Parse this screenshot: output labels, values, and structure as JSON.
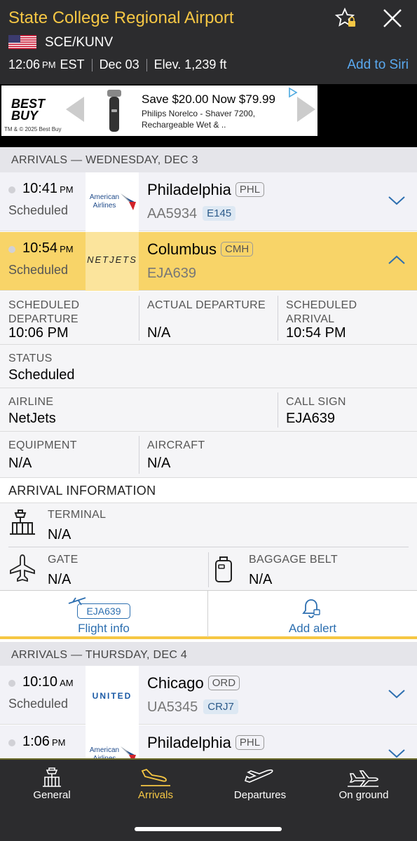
{
  "header": {
    "title": "State College Regional Airport",
    "codes": "SCE/KUNV",
    "time": "12:06",
    "time_ampm": "PM",
    "timezone": "EST",
    "date": "Dec 03",
    "elevation": "Elev. 1,239 ft",
    "siri_label": "Add to Siri",
    "accent_color": "#f6c744"
  },
  "ad": {
    "brand": "BEST BUY",
    "legal": "TM & © 2025 Best Buy",
    "headline": "Save $20.00 Now $79.99",
    "line1": "Philips Norelco - Shaver 7200,",
    "line2": "Rechargeable Wet & .."
  },
  "sections": [
    {
      "heading": "ARRIVALS — WEDNESDAY, DEC 3",
      "flights": [
        {
          "time": "10:41",
          "ampm": "PM",
          "status": "Scheduled",
          "airline_logo": "American Airlines",
          "city": "Philadelphia",
          "iata": "PHL",
          "flight": "AA5934",
          "equipment": "E145"
        },
        {
          "time": "10:54",
          "ampm": "PM",
          "status": "Scheduled",
          "airline_logo": "NETJETS",
          "city": "Columbus",
          "iata": "CMH",
          "flight": "EJA639",
          "equipment": ""
        }
      ]
    },
    {
      "heading": "ARRIVALS — THURSDAY, DEC 4",
      "flights": [
        {
          "time": "10:10",
          "ampm": "AM",
          "status": "Scheduled",
          "airline_logo": "UNITED",
          "city": "Chicago",
          "iata": "ORD",
          "flight": "UA5345",
          "equipment": "CRJ7"
        },
        {
          "time": "1:06",
          "ampm": "PM",
          "status": "",
          "airline_logo": "American Airlines",
          "city": "Philadelphia",
          "iata": "PHL",
          "flight": "",
          "equipment": ""
        }
      ]
    }
  ],
  "detail": {
    "sched_dep_label_1": "SCHEDULED",
    "sched_dep_label_2": "DEPARTURE",
    "sched_dep_value": "10:06 PM",
    "actual_dep_label": "ACTUAL DEPARTURE",
    "actual_dep_value": "N/A",
    "sched_arr_label_1": "SCHEDULED",
    "sched_arr_label_2": "ARRIVAL",
    "sched_arr_value": "10:54 PM",
    "status_label": "STATUS",
    "status_value": "Scheduled",
    "airline_label": "AIRLINE",
    "airline_value": "NetJets",
    "callsign_label": "CALL SIGN",
    "callsign_value": "EJA639",
    "equipment_label": "EQUIPMENT",
    "equipment_value": "N/A",
    "aircraft_label": "AIRCRAFT",
    "aircraft_value": "N/A",
    "arrival_info_heading": "ARRIVAL INFORMATION",
    "terminal_label": "TERMINAL",
    "terminal_value": "N/A",
    "gate_label": "GATE",
    "gate_value": "N/A",
    "baggage_label": "BAGGAGE BELT",
    "baggage_value": "N/A",
    "flight_info_pill": "EJA639",
    "flight_info_label": "Flight info",
    "add_alert_label": "Add alert"
  },
  "tabs": [
    {
      "label": "General",
      "icon": "control-tower-icon",
      "active": false
    },
    {
      "label": "Arrivals",
      "icon": "plane-landing-icon",
      "active": true
    },
    {
      "label": "Departures",
      "icon": "plane-takeoff-icon",
      "active": false
    },
    {
      "label": "On ground",
      "icon": "plane-ground-icon",
      "active": false
    }
  ]
}
